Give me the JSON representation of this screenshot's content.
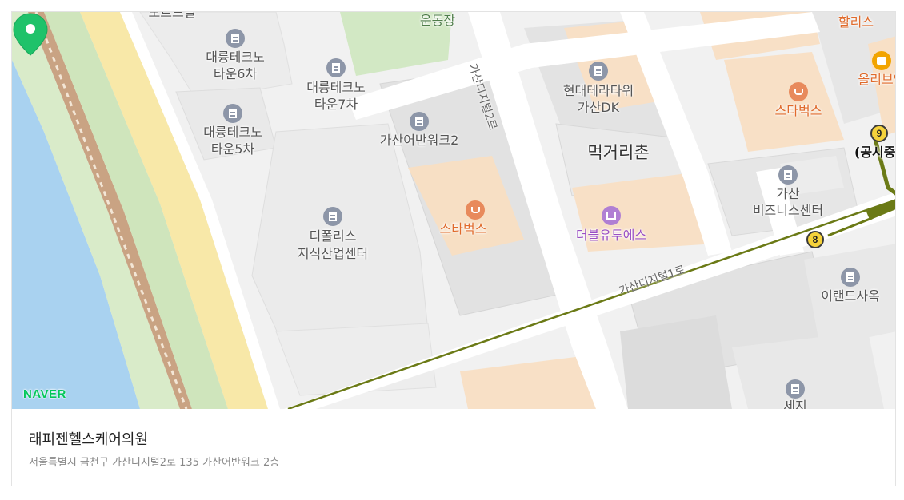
{
  "map": {
    "brand": "NAVER",
    "colors": {
      "green_pin": "#1fc26a",
      "water": "#a9d2f0",
      "park": "#d6e8c6",
      "highway": "#f7e7a7",
      "subway_line_7": "#6b7a16",
      "building": "#f9e3c9"
    },
    "labels": {
      "top_cut": "노르드멀",
      "stadium": "운동장",
      "hollys": "할리스",
      "town6_line1": "대륭테크노",
      "town6_line2": "타운6차",
      "town7_line1": "대륭테크노",
      "town7_line2": "타운7차",
      "town5_line1": "대륭테크노",
      "town5_line2": "타운5차",
      "hyundai_line1": "현대테라타워",
      "hyundai_line2": "가산DK",
      "starbucks_top": "스타벅스",
      "oliveyoung": "올리브영",
      "gasan_work2": "가산어반워크2",
      "food_street": "먹거리촌",
      "gasan_biz_line1": "가산",
      "gasan_biz_line2": "비즈니스센터",
      "gongdan": "(공시중",
      "starbucks_main": "스타벅스",
      "double_u": "더블유투에스",
      "dplace_line1": "디폴리스",
      "dplace_line2": "지식산업센터",
      "iland": "이랜드사옥",
      "seji": "세지",
      "road_digital2": "가산디지털2로",
      "road_digital1": "가산디지털1로"
    },
    "subway": {
      "line9": "9",
      "line8": "8"
    },
    "icons": [
      "building-icon",
      "cafe-icon",
      "beauty-icon",
      "mart-icon",
      "location-pin-icon",
      "subway-icon"
    ]
  },
  "place": {
    "name": "래피젠헬스케어의원",
    "address": "서울특별시 금천구 가산디지털2로 135 가산어반워크 2층"
  }
}
